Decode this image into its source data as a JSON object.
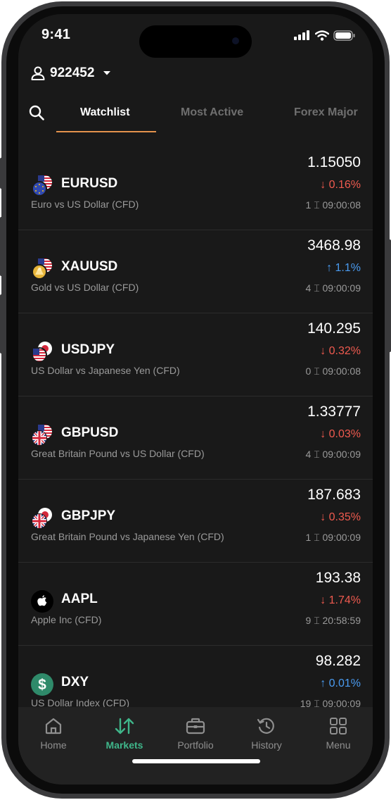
{
  "status_bar": {
    "time": "9:41"
  },
  "account": {
    "number": "922452"
  },
  "tabs": [
    {
      "label": "Watchlist",
      "active": true
    },
    {
      "label": "Most Active",
      "active": false
    },
    {
      "label": "Forex Major",
      "active": false
    }
  ],
  "colors": {
    "accent_tab": "#e3924c",
    "down": "#ef5a4f",
    "up": "#4a9bf0",
    "nav_active": "#3fb68a"
  },
  "instruments": [
    {
      "symbol": "EURUSD",
      "description": "Euro vs US Dollar (CFD)",
      "price": "1.15050",
      "change": "↓ 0.16%",
      "direction": "down",
      "meta": "1 ⌶ 09:00:08",
      "icon": "eu-us-flags-icon"
    },
    {
      "symbol": "XAUUSD",
      "description": "Gold vs US Dollar (CFD)",
      "price": "3468.98",
      "change": "↑ 1.1%",
      "direction": "up",
      "meta": "4 ⌶ 09:00:09",
      "icon": "gold-us-icon"
    },
    {
      "symbol": "USDJPY",
      "description": "US Dollar vs Japanese Yen (CFD)",
      "price": "140.295",
      "change": "↓ 0.32%",
      "direction": "down",
      "meta": "0 ⌶ 09:00:08",
      "icon": "us-jp-flags-icon"
    },
    {
      "symbol": "GBPUSD",
      "description": "Great Britain Pound vs US Dollar (CFD)",
      "price": "1.33777",
      "change": "↓ 0.03%",
      "direction": "down",
      "meta": "4 ⌶ 09:00:09",
      "icon": "gb-us-flags-icon"
    },
    {
      "symbol": "GBPJPY",
      "description": "Great Britain Pound vs Japanese Yen (CFD)",
      "price": "187.683",
      "change": "↓ 0.35%",
      "direction": "down",
      "meta": "1 ⌶ 09:00:09",
      "icon": "gb-jp-flags-icon"
    },
    {
      "symbol": "AAPL",
      "description": "Apple Inc (CFD)",
      "price": "193.38",
      "change": "↓ 1.74%",
      "direction": "down",
      "meta": "9 ⌶ 20:58:59",
      "icon": "apple-logo-icon"
    },
    {
      "symbol": "DXY",
      "description": "US Dollar Index (CFD)",
      "price": "98.282",
      "change": "↑ 0.01%",
      "direction": "up",
      "meta": "19 ⌶ 09:00:09",
      "icon": "dollar-icon"
    }
  ],
  "nav": [
    {
      "label": "Home",
      "icon": "home-icon",
      "active": false
    },
    {
      "label": "Markets",
      "icon": "markets-arrows-icon",
      "active": true
    },
    {
      "label": "Portfolio",
      "icon": "briefcase-icon",
      "active": false
    },
    {
      "label": "History",
      "icon": "history-icon",
      "active": false
    },
    {
      "label": "Menu",
      "icon": "grid-icon",
      "active": false
    }
  ]
}
